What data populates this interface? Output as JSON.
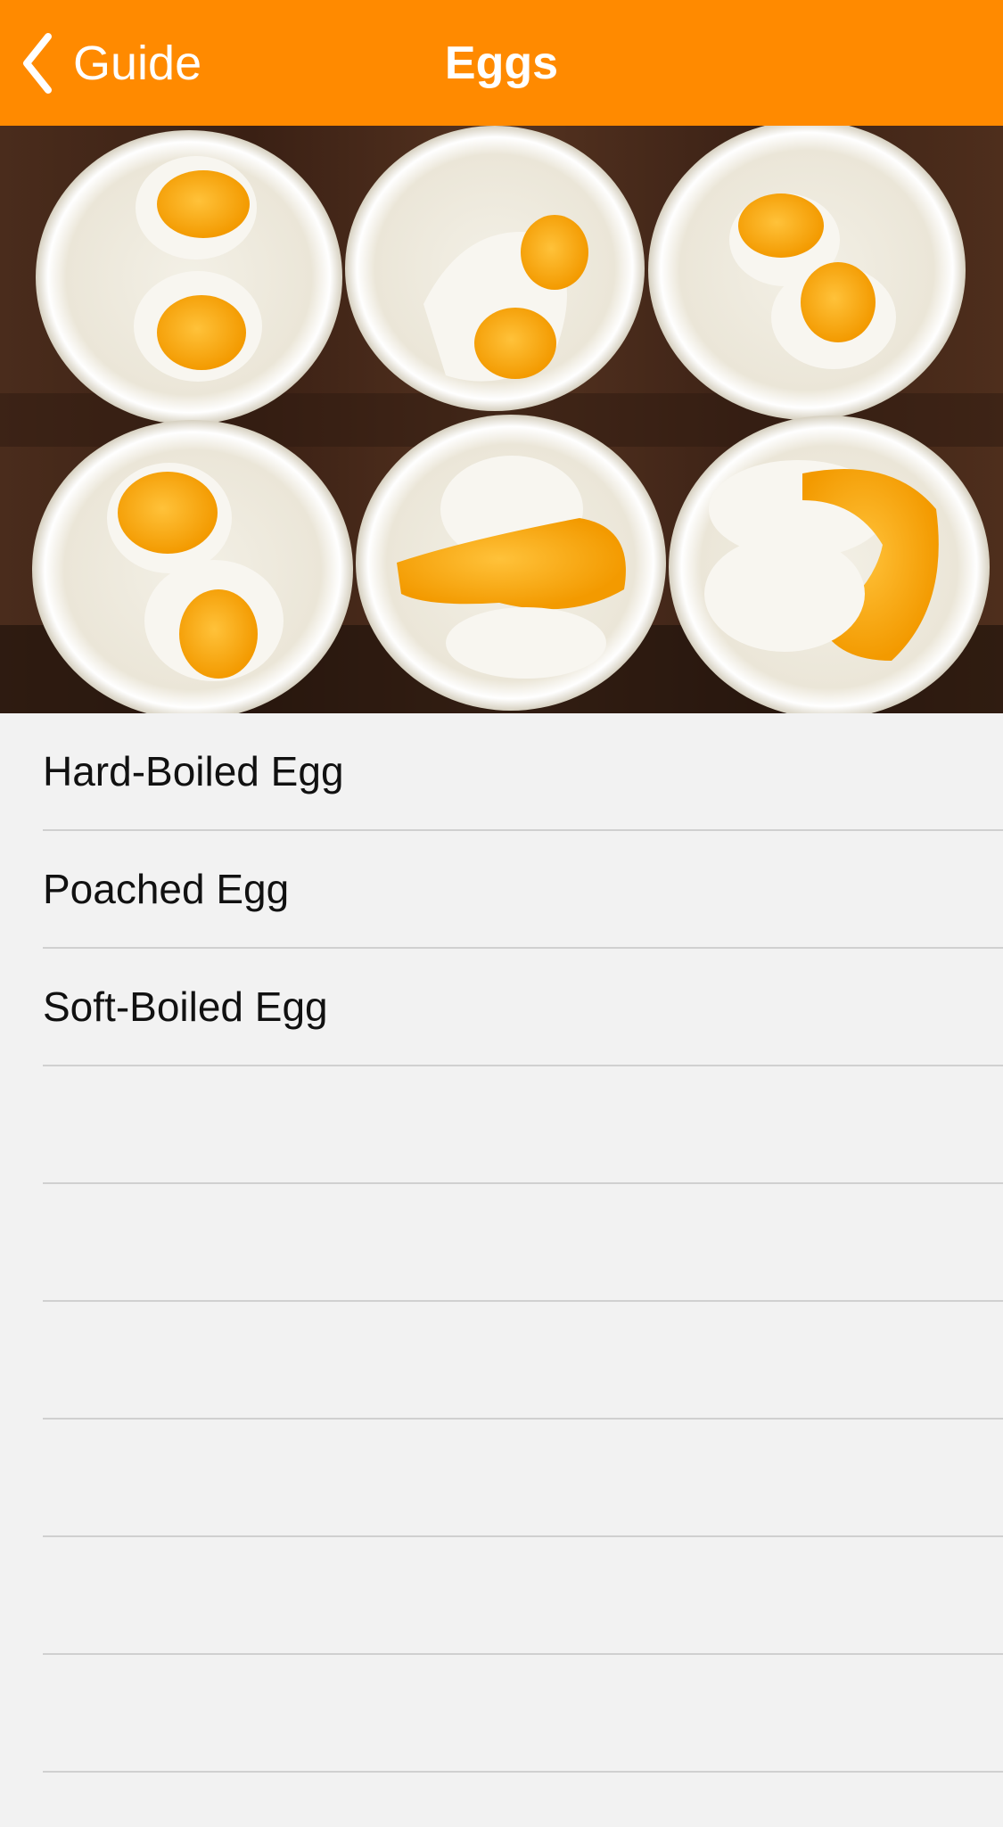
{
  "navbar": {
    "back_label": "Guide",
    "title": "Eggs",
    "color": "#ff8a00"
  },
  "hero": {
    "icon": "egg-bowls-photo"
  },
  "list": {
    "items": [
      {
        "label": "Hard-Boiled Egg"
      },
      {
        "label": "Poached Egg"
      },
      {
        "label": "Soft-Boiled Egg"
      },
      {
        "label": ""
      },
      {
        "label": ""
      },
      {
        "label": ""
      },
      {
        "label": ""
      },
      {
        "label": ""
      },
      {
        "label": ""
      }
    ]
  }
}
